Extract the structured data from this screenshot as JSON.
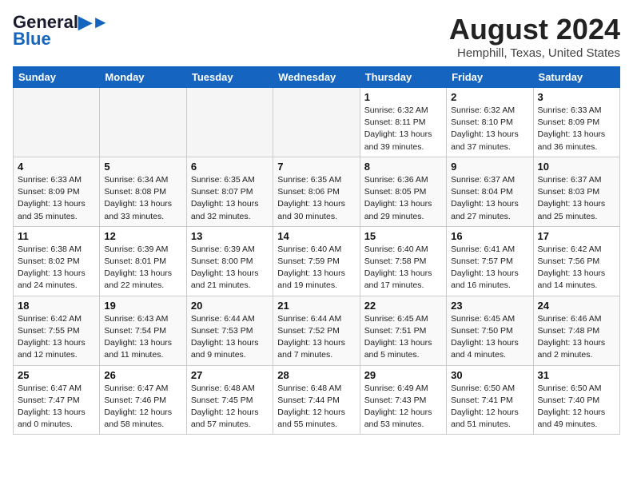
{
  "header": {
    "logo_general": "General",
    "logo_blue": "Blue",
    "month_title": "August 2024",
    "location": "Hemphill, Texas, United States"
  },
  "weekdays": [
    "Sunday",
    "Monday",
    "Tuesday",
    "Wednesday",
    "Thursday",
    "Friday",
    "Saturday"
  ],
  "weeks": [
    [
      {
        "day": "",
        "info": ""
      },
      {
        "day": "",
        "info": ""
      },
      {
        "day": "",
        "info": ""
      },
      {
        "day": "",
        "info": ""
      },
      {
        "day": "1",
        "info": "Sunrise: 6:32 AM\nSunset: 8:11 PM\nDaylight: 13 hours\nand 39 minutes."
      },
      {
        "day": "2",
        "info": "Sunrise: 6:32 AM\nSunset: 8:10 PM\nDaylight: 13 hours\nand 37 minutes."
      },
      {
        "day": "3",
        "info": "Sunrise: 6:33 AM\nSunset: 8:09 PM\nDaylight: 13 hours\nand 36 minutes."
      }
    ],
    [
      {
        "day": "4",
        "info": "Sunrise: 6:33 AM\nSunset: 8:09 PM\nDaylight: 13 hours\nand 35 minutes."
      },
      {
        "day": "5",
        "info": "Sunrise: 6:34 AM\nSunset: 8:08 PM\nDaylight: 13 hours\nand 33 minutes."
      },
      {
        "day": "6",
        "info": "Sunrise: 6:35 AM\nSunset: 8:07 PM\nDaylight: 13 hours\nand 32 minutes."
      },
      {
        "day": "7",
        "info": "Sunrise: 6:35 AM\nSunset: 8:06 PM\nDaylight: 13 hours\nand 30 minutes."
      },
      {
        "day": "8",
        "info": "Sunrise: 6:36 AM\nSunset: 8:05 PM\nDaylight: 13 hours\nand 29 minutes."
      },
      {
        "day": "9",
        "info": "Sunrise: 6:37 AM\nSunset: 8:04 PM\nDaylight: 13 hours\nand 27 minutes."
      },
      {
        "day": "10",
        "info": "Sunrise: 6:37 AM\nSunset: 8:03 PM\nDaylight: 13 hours\nand 25 minutes."
      }
    ],
    [
      {
        "day": "11",
        "info": "Sunrise: 6:38 AM\nSunset: 8:02 PM\nDaylight: 13 hours\nand 24 minutes."
      },
      {
        "day": "12",
        "info": "Sunrise: 6:39 AM\nSunset: 8:01 PM\nDaylight: 13 hours\nand 22 minutes."
      },
      {
        "day": "13",
        "info": "Sunrise: 6:39 AM\nSunset: 8:00 PM\nDaylight: 13 hours\nand 21 minutes."
      },
      {
        "day": "14",
        "info": "Sunrise: 6:40 AM\nSunset: 7:59 PM\nDaylight: 13 hours\nand 19 minutes."
      },
      {
        "day": "15",
        "info": "Sunrise: 6:40 AM\nSunset: 7:58 PM\nDaylight: 13 hours\nand 17 minutes."
      },
      {
        "day": "16",
        "info": "Sunrise: 6:41 AM\nSunset: 7:57 PM\nDaylight: 13 hours\nand 16 minutes."
      },
      {
        "day": "17",
        "info": "Sunrise: 6:42 AM\nSunset: 7:56 PM\nDaylight: 13 hours\nand 14 minutes."
      }
    ],
    [
      {
        "day": "18",
        "info": "Sunrise: 6:42 AM\nSunset: 7:55 PM\nDaylight: 13 hours\nand 12 minutes."
      },
      {
        "day": "19",
        "info": "Sunrise: 6:43 AM\nSunset: 7:54 PM\nDaylight: 13 hours\nand 11 minutes."
      },
      {
        "day": "20",
        "info": "Sunrise: 6:44 AM\nSunset: 7:53 PM\nDaylight: 13 hours\nand 9 minutes."
      },
      {
        "day": "21",
        "info": "Sunrise: 6:44 AM\nSunset: 7:52 PM\nDaylight: 13 hours\nand 7 minutes."
      },
      {
        "day": "22",
        "info": "Sunrise: 6:45 AM\nSunset: 7:51 PM\nDaylight: 13 hours\nand 5 minutes."
      },
      {
        "day": "23",
        "info": "Sunrise: 6:45 AM\nSunset: 7:50 PM\nDaylight: 13 hours\nand 4 minutes."
      },
      {
        "day": "24",
        "info": "Sunrise: 6:46 AM\nSunset: 7:48 PM\nDaylight: 13 hours\nand 2 minutes."
      }
    ],
    [
      {
        "day": "25",
        "info": "Sunrise: 6:47 AM\nSunset: 7:47 PM\nDaylight: 13 hours\nand 0 minutes."
      },
      {
        "day": "26",
        "info": "Sunrise: 6:47 AM\nSunset: 7:46 PM\nDaylight: 12 hours\nand 58 minutes."
      },
      {
        "day": "27",
        "info": "Sunrise: 6:48 AM\nSunset: 7:45 PM\nDaylight: 12 hours\nand 57 minutes."
      },
      {
        "day": "28",
        "info": "Sunrise: 6:48 AM\nSunset: 7:44 PM\nDaylight: 12 hours\nand 55 minutes."
      },
      {
        "day": "29",
        "info": "Sunrise: 6:49 AM\nSunset: 7:43 PM\nDaylight: 12 hours\nand 53 minutes."
      },
      {
        "day": "30",
        "info": "Sunrise: 6:50 AM\nSunset: 7:41 PM\nDaylight: 12 hours\nand 51 minutes."
      },
      {
        "day": "31",
        "info": "Sunrise: 6:50 AM\nSunset: 7:40 PM\nDaylight: 12 hours\nand 49 minutes."
      }
    ]
  ]
}
